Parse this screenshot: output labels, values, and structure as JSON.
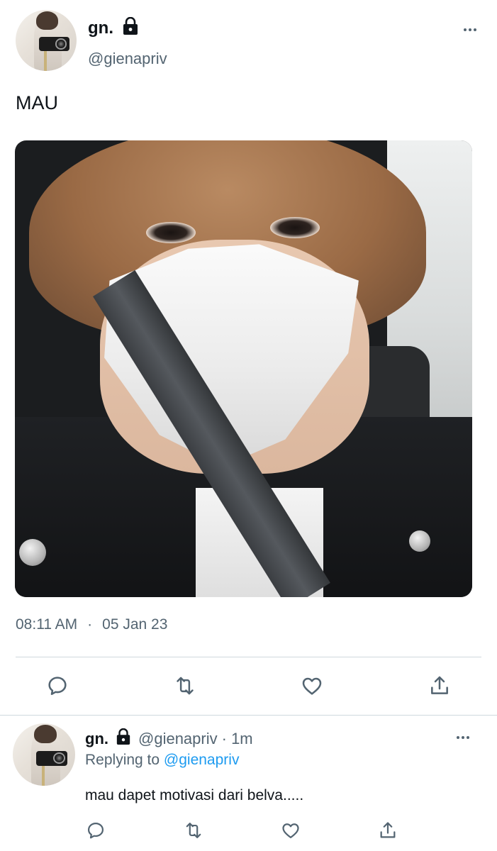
{
  "tweet": {
    "author_name": "gn.",
    "author_handle": "@gienapriv",
    "text": "MAU",
    "time": "08:11 AM",
    "separator": "·",
    "date": "05 Jan 23"
  },
  "reply": {
    "author_name": "gn.",
    "author_handle": "@gienapriv",
    "age": "· 1m",
    "replying_prefix": "Replying to",
    "replying_to": "@gienapriv",
    "text": "mau dapet motivasi dari belva....."
  },
  "icons": [
    "lock-icon",
    "more-icon",
    "reply-icon",
    "retweet-icon",
    "like-icon",
    "share-icon"
  ],
  "colors": {
    "text": "#0f1419",
    "secondary": "#536471",
    "link": "#1d9bf0",
    "divider": "#cfd9de"
  }
}
